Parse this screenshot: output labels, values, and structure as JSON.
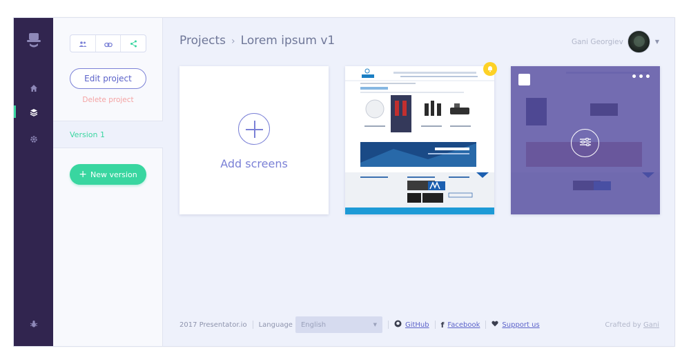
{
  "nav": {
    "logo": "presentator-logo",
    "items": [
      {
        "icon": "home-icon"
      },
      {
        "icon": "layers-icon",
        "active": true
      },
      {
        "icon": "gear-icon"
      }
    ],
    "bottom_icon": "bug-icon",
    "accent": "#39d6a0",
    "bg": "#31254f"
  },
  "panel": {
    "tools": [
      "users-icon",
      "link-icon",
      "share-icon"
    ],
    "edit_label": "Edit project",
    "delete_label": "Delete project",
    "versions": [
      {
        "label": "Version 1"
      }
    ],
    "new_version_label": "New version"
  },
  "header": {
    "breadcrumb_root": "Projects",
    "breadcrumb_sep": "›",
    "breadcrumb_current": "Lorem ipsum v1",
    "user_name": "Gani Georgiev"
  },
  "screens": {
    "add_label": "Add screens",
    "items": [
      {
        "name": "screen-thumb-1",
        "has_notification": true
      },
      {
        "name": "screen-thumb-2",
        "selected_overlay": true
      }
    ]
  },
  "footer": {
    "copyright": "2017 Presentator.io",
    "language_label": "Language",
    "language_value": "English",
    "github": "GitHub",
    "facebook": "Facebook",
    "support": "Support us",
    "crafted_prefix": "Crafted by",
    "crafted_name": "Gani"
  }
}
